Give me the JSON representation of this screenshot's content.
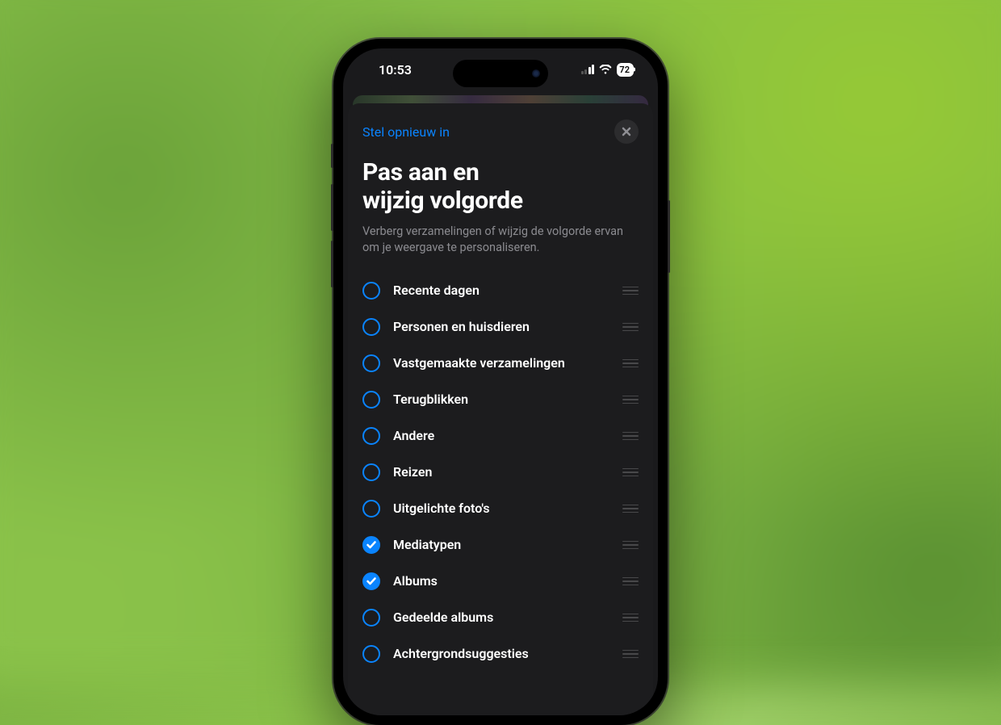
{
  "status": {
    "time": "10:53",
    "battery": "72"
  },
  "sheet": {
    "reset_label": "Stel opnieuw in",
    "title_line1": "Pas aan en",
    "title_line2": "wijzig volgorde",
    "description": "Verberg verzamelingen of wijzig de volgorde ervan om je weergave te personaliseren."
  },
  "items": [
    {
      "label": "Recente dagen",
      "checked": false
    },
    {
      "label": "Personen en huisdieren",
      "checked": false
    },
    {
      "label": "Vastgemaakte verzamelingen",
      "checked": false
    },
    {
      "label": "Terugblikken",
      "checked": false
    },
    {
      "label": "Andere",
      "checked": false
    },
    {
      "label": "Reizen",
      "checked": false
    },
    {
      "label": "Uitgelichte foto's",
      "checked": false
    },
    {
      "label": "Mediatypen",
      "checked": true
    },
    {
      "label": "Albums",
      "checked": true
    },
    {
      "label": "Gedeelde albums",
      "checked": false
    },
    {
      "label": "Achtergrondsuggesties",
      "checked": false
    }
  ]
}
